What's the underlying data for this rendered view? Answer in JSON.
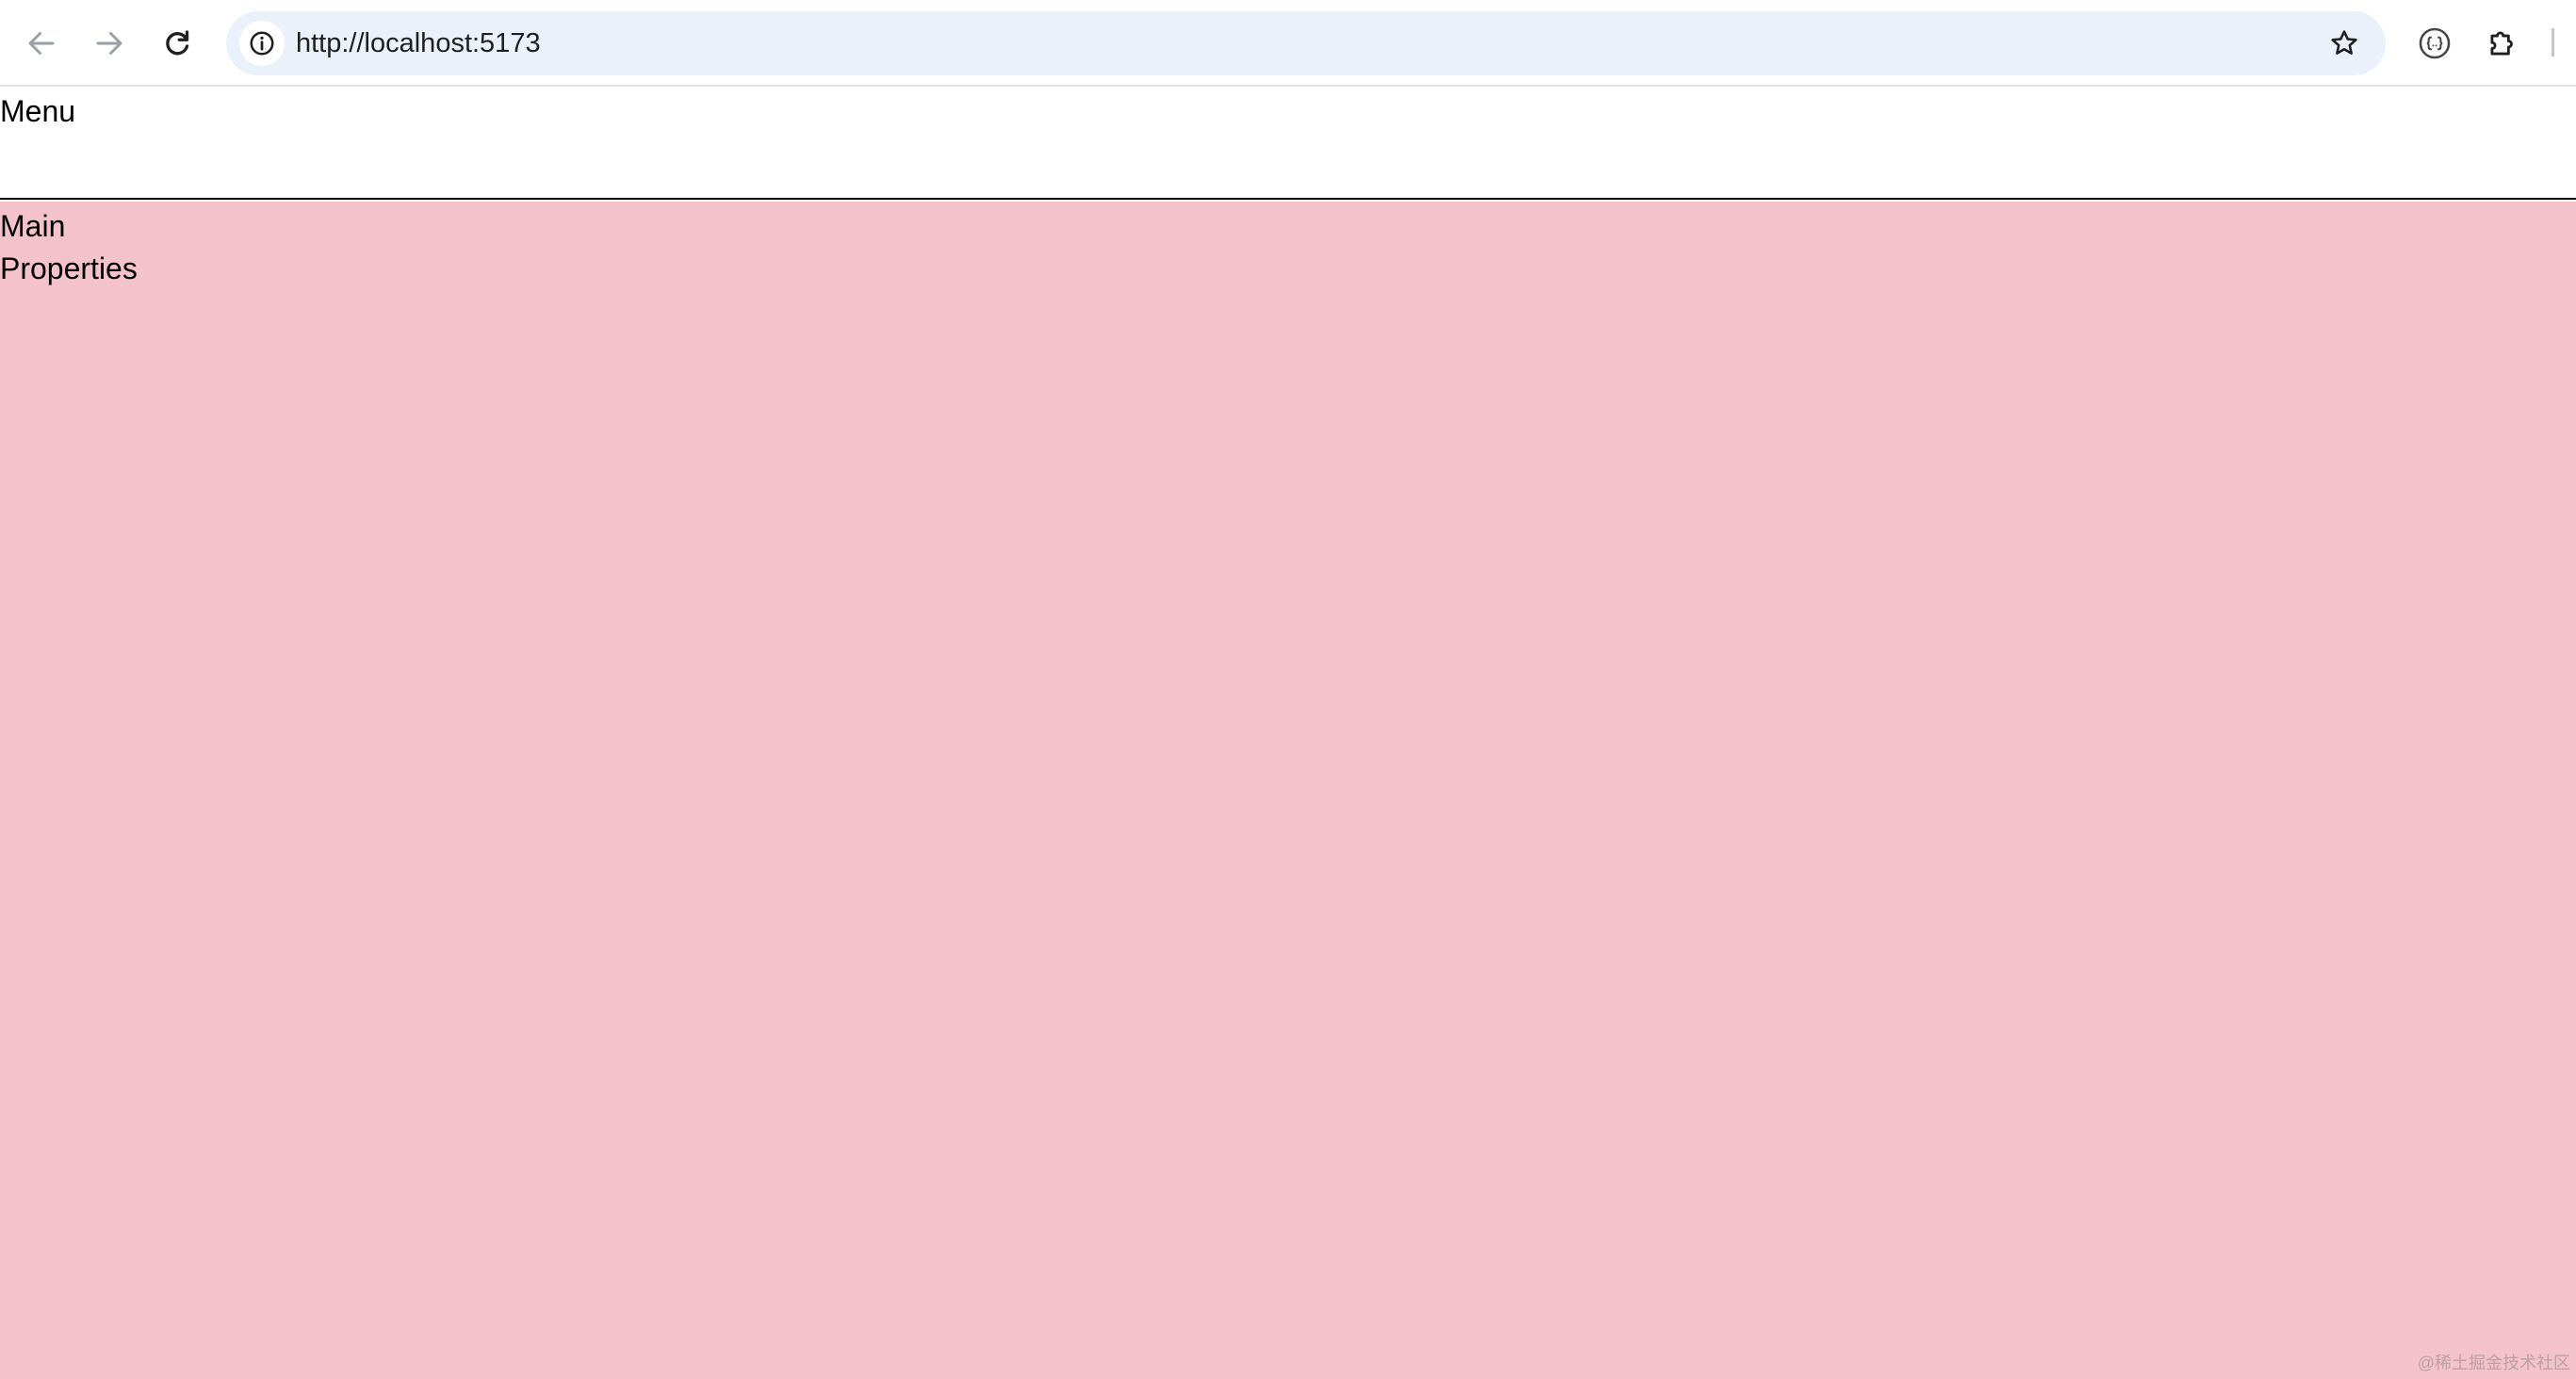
{
  "browser": {
    "url": "http://localhost:5173",
    "icons": {
      "back": "arrow-left-icon",
      "forward": "arrow-right-icon",
      "reload": "reload-icon",
      "site_info": "info-icon",
      "bookmark": "star-icon",
      "json_extension": "json-viewer-icon",
      "extensions": "puzzle-icon"
    }
  },
  "page": {
    "menu_label": "Menu",
    "main_label": "Main",
    "properties_label": "Properties",
    "watermark": "@稀土掘金技术社区"
  },
  "colors": {
    "omnibox_bg": "#eaf1fb",
    "main_bg": "#f4c2cb",
    "menu_bg": "#ffffff",
    "divider": "#000000"
  }
}
